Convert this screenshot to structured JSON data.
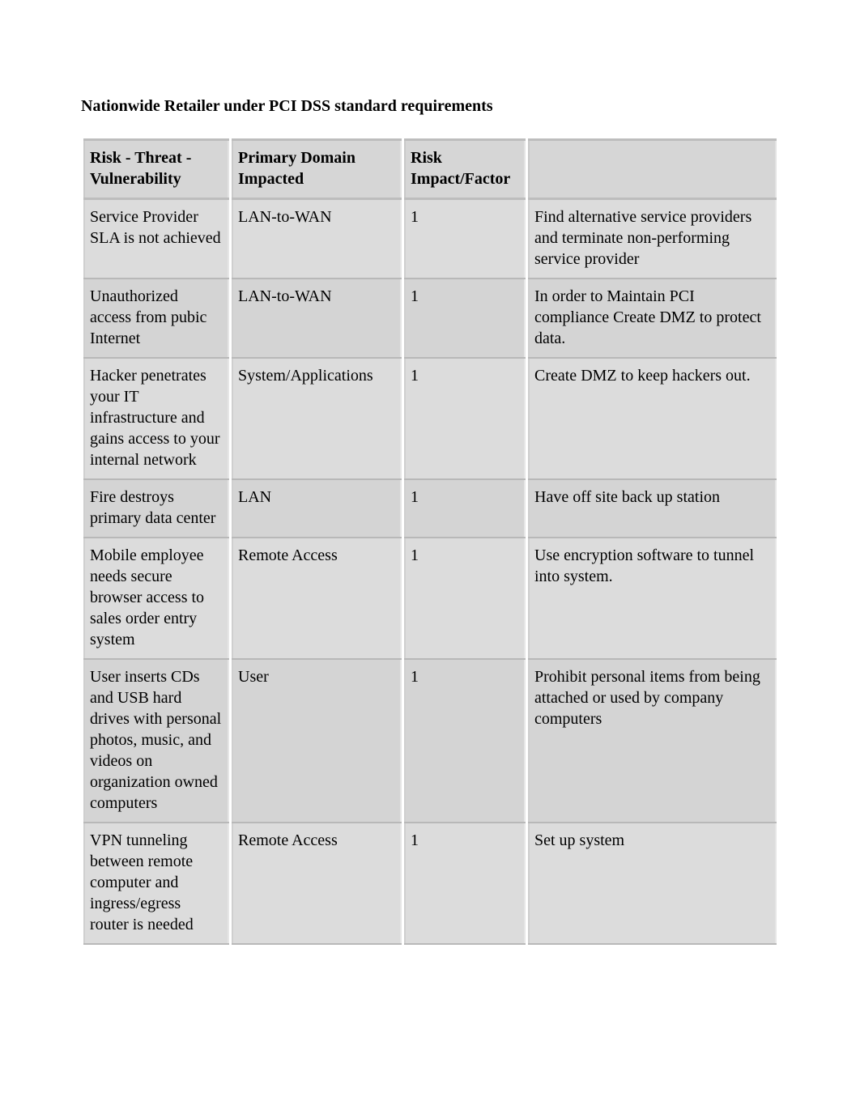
{
  "title": "Nationwide Retailer under PCI DSS standard requirements",
  "headers": {
    "c0": "Risk - Threat - Vulnerability",
    "c1": "Primary Domain Impacted",
    "c2": "Risk Impact/Factor",
    "c3": ""
  },
  "rows": [
    {
      "risk": "Service Provider SLA is not achieved",
      "domain": "LAN-to-WAN",
      "impact": "1",
      "action": "Find alternative service providers and terminate non-performing service provider"
    },
    {
      "risk": "Unauthorized access from pubic Internet",
      "domain": "LAN-to-WAN",
      "impact": "1",
      "action": "In order to Maintain PCI compliance Create DMZ to protect data."
    },
    {
      "risk": "Hacker penetrates your IT infrastructure and gains access to your internal network",
      "domain": "System/Applications",
      "impact": "1",
      "action": "Create DMZ to keep hackers out."
    },
    {
      "risk": "Fire destroys primary data center",
      "domain": "LAN",
      "impact": "1",
      "action": "Have off site back up station"
    },
    {
      "risk": "Mobile employee needs secure browser access to sales order entry system",
      "domain": "Remote Access",
      "impact": "1",
      "action": "Use encryption software to tunnel into system."
    },
    {
      "risk": "User inserts CDs and USB hard drives with personal photos, music, and videos on organization owned computers",
      "domain": "User",
      "impact": "1",
      "action": "Prohibit personal items from being attached or used by company computers"
    },
    {
      "risk": "VPN tunneling between remote computer and ingress/egress router is needed",
      "domain": "Remote Access",
      "impact": "1",
      "action": "Set up system"
    }
  ]
}
